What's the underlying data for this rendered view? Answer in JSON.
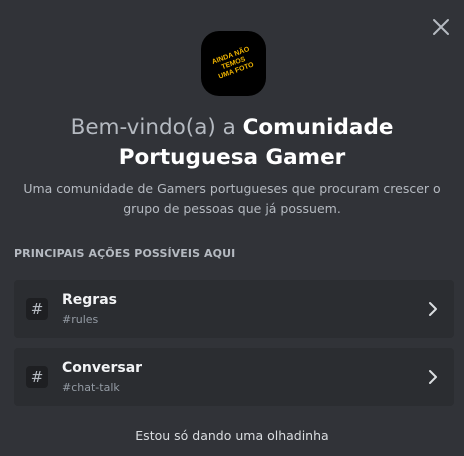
{
  "server": {
    "icon_text": "AINDA NÃO\nTEMOS\nUMA FOTO",
    "welcome_prefix": "Bem-vindo(a) a ",
    "name": "Comunidade Portuguesa Gamer",
    "description": "Uma comunidade de Gamers portugueses que procuram crescer o grupo de pessoas que já possuem."
  },
  "section_title": "PRINCIPAIS AÇÕES POSSÍVEIS AQUI",
  "actions": [
    {
      "label": "Regras",
      "channel": "#rules",
      "icon": "hash-icon"
    },
    {
      "label": "Conversar",
      "channel": "#chat-talk",
      "icon": "hash-icon"
    }
  ],
  "hash_symbol": "#",
  "footer_link": "Estou só dando uma olhadinha",
  "colors": {
    "background": "#313338",
    "card": "#2b2d31",
    "icon_text": "#f0b400"
  }
}
